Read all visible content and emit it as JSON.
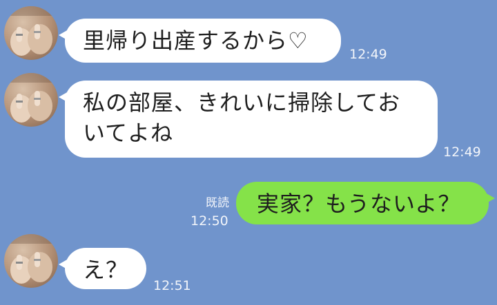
{
  "messages": [
    {
      "direction": "incoming",
      "text": "里帰り出産するから♡",
      "time": "12:49"
    },
    {
      "direction": "incoming",
      "text": "私の部屋、きれいに掃除しておいてよね",
      "time": "12:49"
    },
    {
      "direction": "outgoing",
      "text": "実家？もうないよ？",
      "time": "12:50",
      "read_label": "既読"
    },
    {
      "direction": "incoming",
      "text": "え？",
      "time": "12:51"
    }
  ],
  "icons": {
    "avatar": "avatar-photo-icon"
  },
  "colors": {
    "background": "#7094cc",
    "incoming_bubble": "#ffffff",
    "outgoing_bubble": "#85e249",
    "timestamp": "#f2f5fa"
  }
}
